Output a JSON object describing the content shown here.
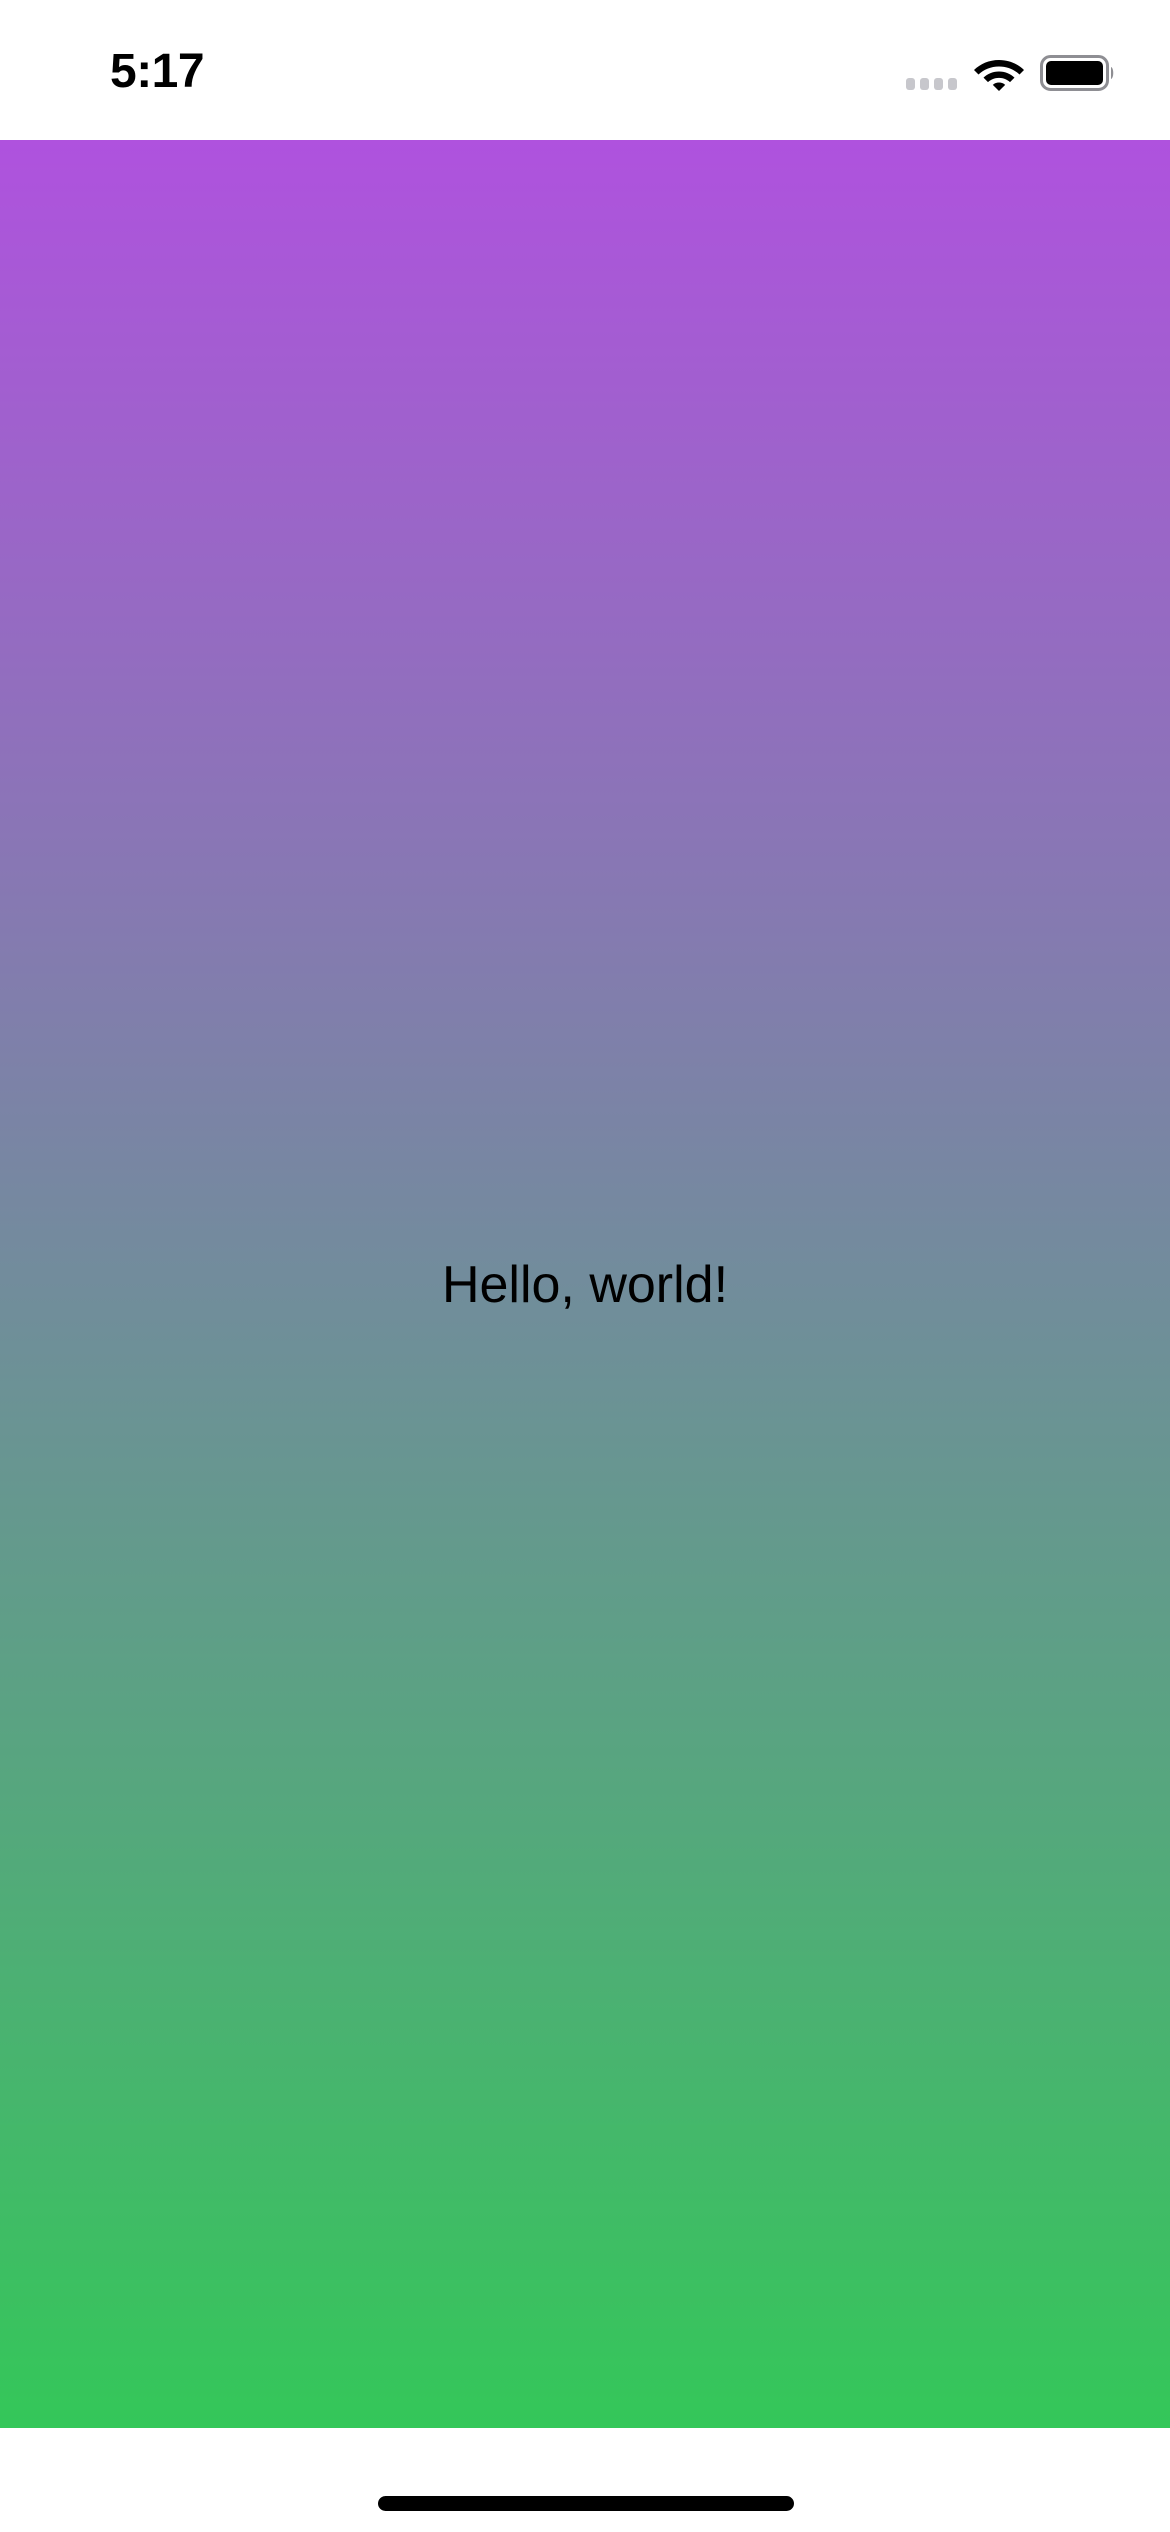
{
  "status_bar": {
    "time": "5:17",
    "signal_icon": "cellular-signal-dots-icon",
    "wifi_icon": "wifi-icon",
    "battery_icon": "battery-icon"
  },
  "main": {
    "text": "Hello, world!",
    "gradient_top_color": "#AF52DE",
    "gradient_bottom_color": "#34C759",
    "text_color": "#000000"
  },
  "home_indicator": {
    "icon": "home-indicator-bar",
    "color": "#000000"
  }
}
